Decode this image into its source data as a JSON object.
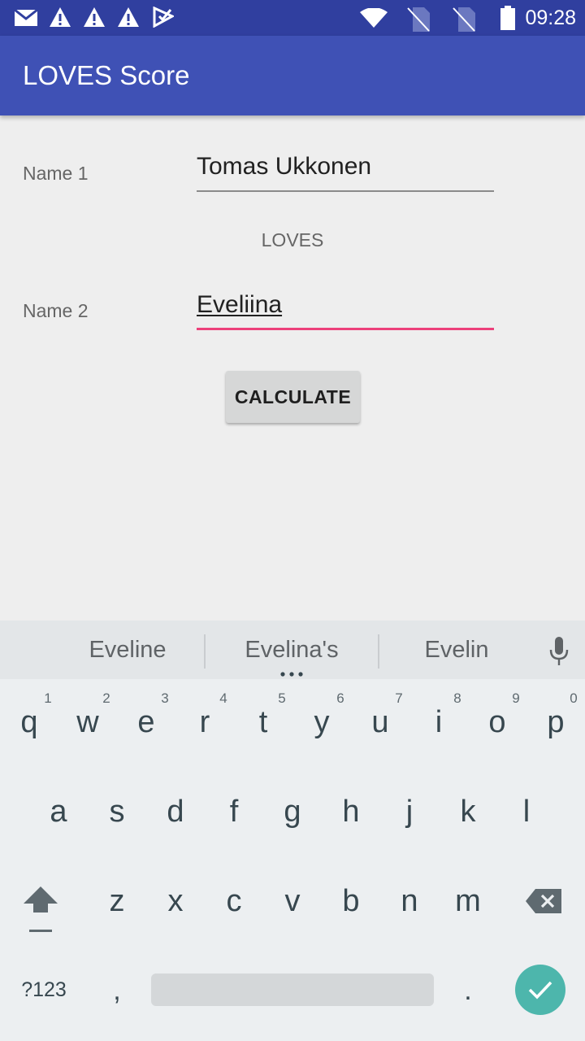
{
  "status_bar": {
    "time": "09:28",
    "icons": [
      "gmail-icon",
      "warning-icon",
      "warning-icon",
      "warning-icon",
      "inbox-check-icon",
      "wifi-icon",
      "no-sim-icon",
      "no-sim-icon",
      "battery-icon"
    ]
  },
  "app_bar": {
    "title": "LOVES Score"
  },
  "form": {
    "name1_label": "Name 1",
    "name1_value": "Tomas Ukkonen",
    "loves_label": "LOVES",
    "name2_label": "Name 2",
    "name2_value": "Eveliina",
    "calculate_label": "CALCULATE"
  },
  "keyboard": {
    "suggestions": [
      "Eveline",
      "Evelina's",
      "Evelin"
    ],
    "row1": [
      "q",
      "w",
      "e",
      "r",
      "t",
      "y",
      "u",
      "i",
      "o",
      "p"
    ],
    "row1_hints": [
      "1",
      "2",
      "3",
      "4",
      "5",
      "6",
      "7",
      "8",
      "9",
      "0"
    ],
    "row2": [
      "a",
      "s",
      "d",
      "f",
      "g",
      "h",
      "j",
      "k",
      "l"
    ],
    "row3": [
      "z",
      "x",
      "c",
      "v",
      "b",
      "n",
      "m"
    ],
    "symbols_label": "?123",
    "comma": ",",
    "period": ".",
    "accent_color": "#4db6ac"
  },
  "colors": {
    "primary": "#3f51b5",
    "primary_dark": "#303f9f",
    "focus_accent": "#ec407a"
  }
}
